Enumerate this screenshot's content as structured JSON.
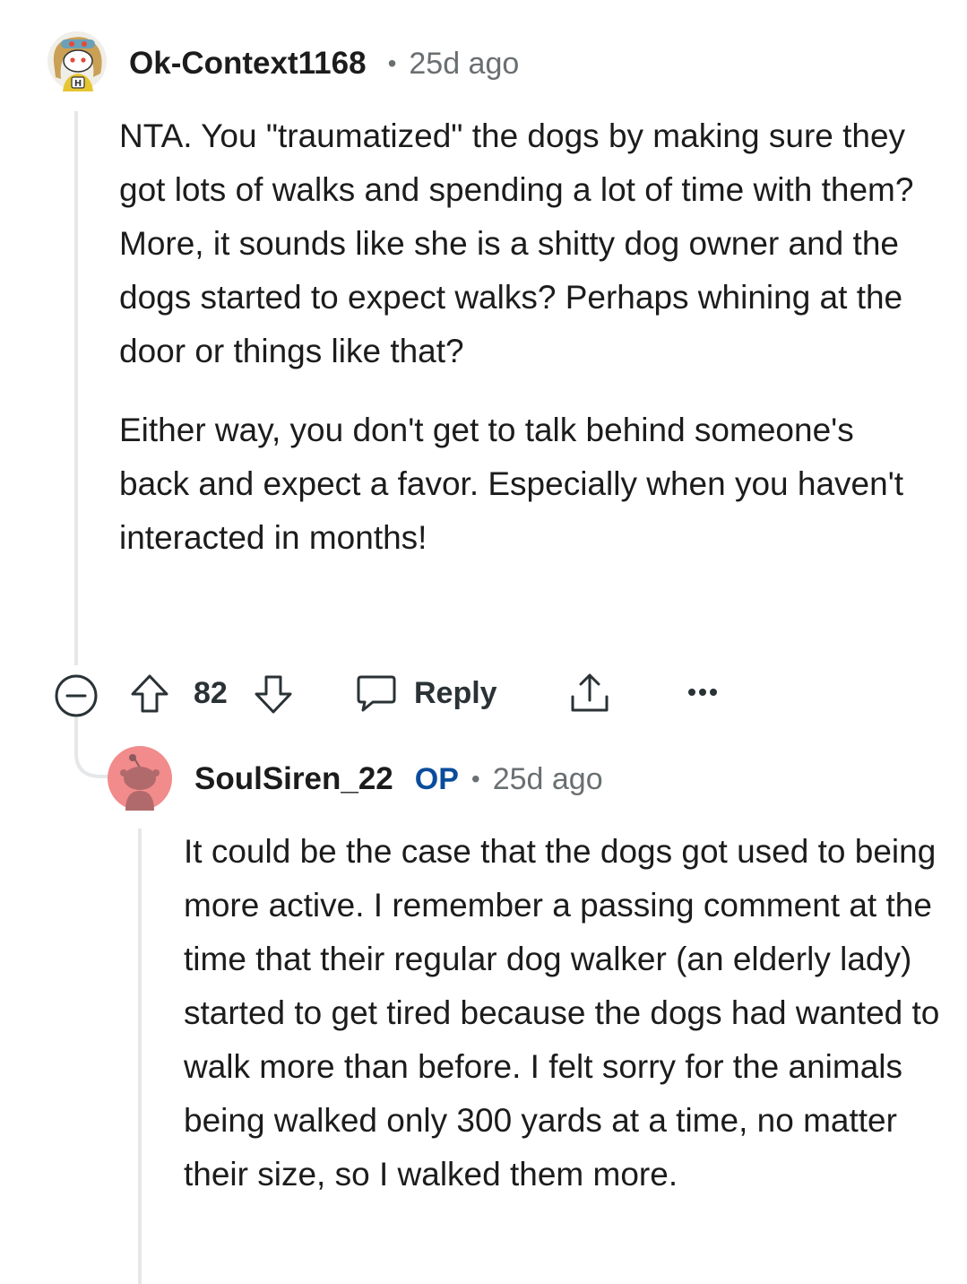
{
  "comment": {
    "author": "Ok-Context1168",
    "separator": "•",
    "age": "25d ago",
    "avatar_icon": "snoo-avatar-icon",
    "paragraphs": [
      "NTA. You \"traumatized\" the dogs by making sure they got lots of walks and spending a lot of time with them? More, it sounds like she is a shitty dog owner and the dogs started to expect walks? Perhaps whining at the door or things like that?",
      "Either way, you don't get to talk behind someone's back and expect a favor. Especially when you haven't interacted in months!"
    ],
    "actions": {
      "score": "82",
      "reply_label": "Reply",
      "collapse_icon": "collapse-minus-icon",
      "upvote_icon": "upvote-arrow-icon",
      "downvote_icon": "downvote-arrow-icon",
      "reply_icon": "speech-bubble-icon",
      "share_icon": "share-icon",
      "more_icon": "more-dots-icon"
    }
  },
  "reply": {
    "author": "SoulSiren_22",
    "op_badge": "OP",
    "separator": "•",
    "age": "25d ago",
    "avatar_icon": "snoo-avatar-icon",
    "avatar_color": "#f28b8b",
    "paragraphs": [
      "It could be the case that the dogs got used to being more active. I remember a passing comment at the time that their regular dog walker (an elderly lady) started to get tired because the dogs had wanted to walk more than before. I felt sorry for the animals being walked only 300 yards at a time, no matter their size, so I walked them more."
    ]
  },
  "colors": {
    "text": "#1c1c1c",
    "meta": "#6a6f72",
    "op": "#0a4c9c",
    "thread_line": "#e5e7e9"
  }
}
